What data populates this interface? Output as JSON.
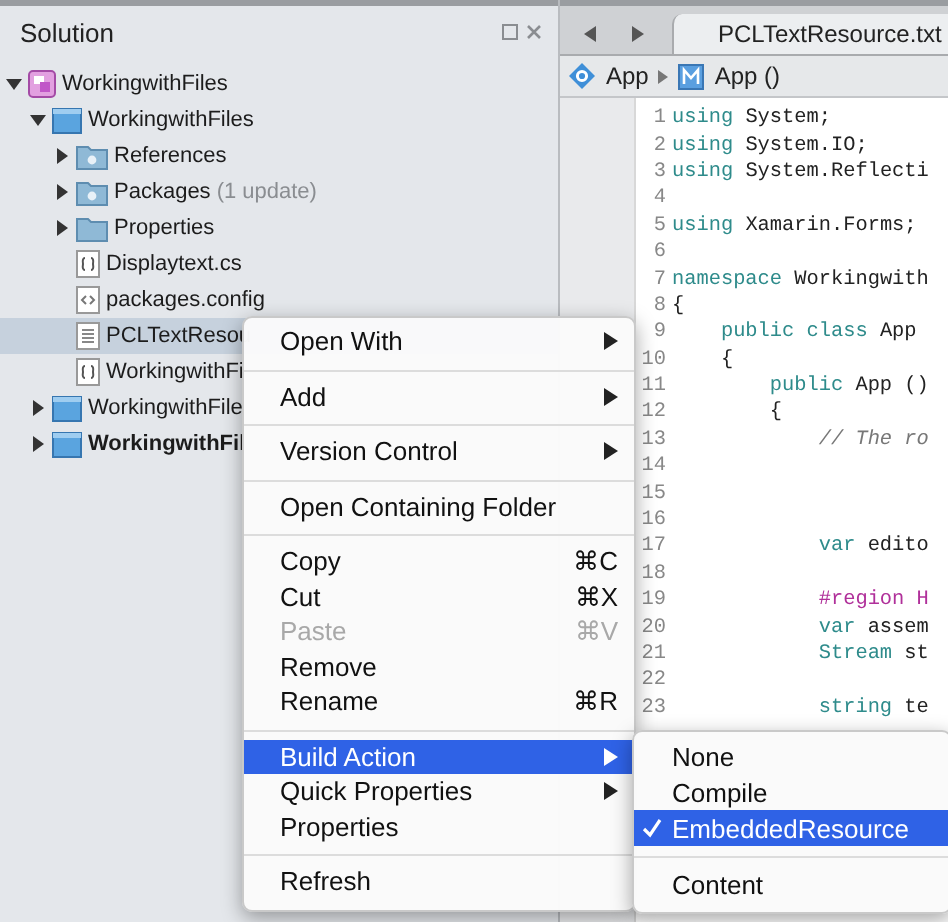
{
  "solution_pad": {
    "title": "Solution",
    "tree": [
      {
        "label": "WorkingwithFiles",
        "kind": "solution",
        "expanded": true,
        "selected": false,
        "bold": false,
        "children": [
          {
            "label": "WorkingwithFiles",
            "kind": "project",
            "expanded": true,
            "selected": false,
            "bold": false,
            "children": [
              {
                "label": "References",
                "kind": "special-folder",
                "expanded": false,
                "selected": false,
                "bold": false
              },
              {
                "label": "Packages",
                "note": "(1 update)",
                "kind": "special-folder",
                "expanded": false,
                "selected": false,
                "bold": false
              },
              {
                "label": "Properties",
                "kind": "folder",
                "expanded": false,
                "selected": false,
                "bold": false
              },
              {
                "label": "Displaytext.cs",
                "kind": "code-file",
                "selected": false,
                "bold": false
              },
              {
                "label": "packages.config",
                "kind": "config-file",
                "selected": false,
                "bold": false
              },
              {
                "label": "PCLTextResou",
                "kind": "text-file",
                "selected": true,
                "bold": false
              },
              {
                "label": "WorkingwithFi",
                "kind": "code-file",
                "selected": false,
                "bold": false
              }
            ]
          },
          {
            "label": "WorkingwithFile",
            "kind": "project",
            "expanded": false,
            "selected": false,
            "bold": false
          },
          {
            "label": "WorkingwithFil",
            "kind": "project",
            "expanded": false,
            "selected": false,
            "bold": true
          }
        ]
      }
    ]
  },
  "editor": {
    "tab": "PCLTextResource.txt",
    "breadcrumb": [
      {
        "label": "App",
        "kind": "class"
      },
      {
        "label": "App ()",
        "kind": "method"
      }
    ],
    "lines": [
      {
        "number": "1",
        "segments": [
          {
            "text": "using",
            "kind": "keyword"
          },
          {
            "text": " System;",
            "kind": "plain"
          }
        ]
      },
      {
        "number": "2",
        "segments": [
          {
            "text": "using",
            "kind": "keyword"
          },
          {
            "text": " System.IO;",
            "kind": "plain"
          }
        ]
      },
      {
        "number": "3",
        "segments": [
          {
            "text": "using",
            "kind": "keyword"
          },
          {
            "text": " System.Reflecti",
            "kind": "plain"
          }
        ]
      },
      {
        "number": "4"
      },
      {
        "number": "5",
        "segments": [
          {
            "text": "using",
            "kind": "keyword"
          },
          {
            "text": " Xamarin.Forms;",
            "kind": "plain"
          }
        ]
      },
      {
        "number": "6"
      },
      {
        "number": "7",
        "segments": [
          {
            "text": "namespace",
            "kind": "keyword"
          },
          {
            "text": " Workingwith",
            "kind": "plain"
          }
        ]
      },
      {
        "number": "8",
        "segments": [
          {
            "text": "{",
            "kind": "plain"
          }
        ]
      },
      {
        "number": "9",
        "segments": [
          {
            "text": "    public class",
            "kind": "keyword"
          },
          {
            "text": " App",
            "kind": "plain"
          }
        ]
      },
      {
        "number": "10",
        "segments": [
          {
            "text": "    {",
            "kind": "plain"
          }
        ]
      },
      {
        "number": "11",
        "segments": [
          {
            "text": "        public",
            "kind": "keyword"
          },
          {
            "text": " App ()",
            "kind": "plain"
          }
        ]
      },
      {
        "number": "12",
        "segments": [
          {
            "text": "        {",
            "kind": "plain"
          }
        ]
      },
      {
        "number": "13",
        "segments": [
          {
            "text": "            // The ro",
            "kind": "comment"
          }
        ]
      },
      {
        "number": "14"
      },
      {
        "number": "15"
      },
      {
        "number": "16"
      },
      {
        "number": "17",
        "segments": [
          {
            "text": "            var",
            "kind": "keyword"
          },
          {
            "text": " edito",
            "kind": "plain"
          }
        ]
      },
      {
        "number": "18"
      },
      {
        "number": "19",
        "segments": [
          {
            "text": "            #region H",
            "kind": "directive"
          }
        ]
      },
      {
        "number": "20",
        "segments": [
          {
            "text": "            var",
            "kind": "keyword"
          },
          {
            "text": " assem",
            "kind": "plain"
          }
        ]
      },
      {
        "number": "21",
        "segments": [
          {
            "text": "            Stream",
            "kind": "keyword"
          },
          {
            "text": " st",
            "kind": "plain"
          }
        ]
      },
      {
        "number": "22"
      },
      {
        "number": "23",
        "segments": [
          {
            "text": "            string",
            "kind": "keyword"
          },
          {
            "text": " te",
            "kind": "plain"
          }
        ]
      }
    ]
  },
  "context_menu": {
    "items": [
      {
        "kind": "item",
        "label": "Open With",
        "submenu": true,
        "selected": false,
        "disabled": false
      },
      {
        "kind": "separator"
      },
      {
        "kind": "item",
        "label": "Add",
        "submenu": true,
        "selected": false,
        "disabled": false
      },
      {
        "kind": "separator"
      },
      {
        "kind": "item",
        "label": "Version Control",
        "submenu": true,
        "selected": false,
        "disabled": false
      },
      {
        "kind": "separator"
      },
      {
        "kind": "item",
        "label": "Open Containing Folder",
        "submenu": false,
        "selected": false,
        "disabled": false
      },
      {
        "kind": "separator"
      },
      {
        "kind": "item",
        "label": "Copy",
        "shortcut": "⌘C",
        "submenu": false,
        "selected": false,
        "disabled": false
      },
      {
        "kind": "item",
        "label": "Cut",
        "shortcut": "⌘X",
        "submenu": false,
        "selected": false,
        "disabled": false
      },
      {
        "kind": "item",
        "label": "Paste",
        "shortcut": "⌘V",
        "submenu": false,
        "selected": false,
        "disabled": true
      },
      {
        "kind": "item",
        "label": "Remove",
        "submenu": false,
        "selected": false,
        "disabled": false
      },
      {
        "kind": "item",
        "label": "Rename",
        "shortcut": "⌘R",
        "submenu": false,
        "selected": false,
        "disabled": false
      },
      {
        "kind": "separator"
      },
      {
        "kind": "item",
        "label": "Build Action",
        "submenu": true,
        "selected": true,
        "disabled": false
      },
      {
        "kind": "item",
        "label": "Quick Properties",
        "submenu": true,
        "selected": false,
        "disabled": false
      },
      {
        "kind": "item",
        "label": "Properties",
        "submenu": false,
        "selected": false,
        "disabled": false
      },
      {
        "kind": "separator"
      },
      {
        "kind": "item",
        "label": "Refresh",
        "submenu": false,
        "selected": false,
        "disabled": false
      }
    ]
  },
  "build_action_menu": {
    "items": [
      {
        "kind": "item",
        "label": "None",
        "checked": false,
        "selected": false
      },
      {
        "kind": "item",
        "label": "Compile",
        "checked": false,
        "selected": false
      },
      {
        "kind": "item",
        "label": "EmbeddedResource",
        "checked": true,
        "selected": true
      },
      {
        "kind": "separator"
      },
      {
        "kind": "item",
        "label": "Content",
        "checked": false,
        "selected": false
      }
    ]
  }
}
